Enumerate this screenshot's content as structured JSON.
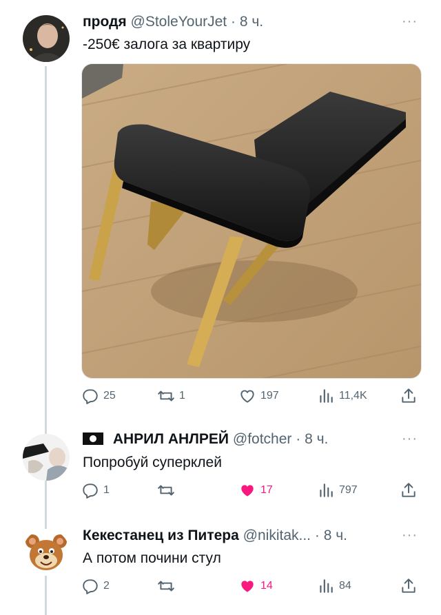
{
  "tweets": [
    {
      "name": "продя",
      "handle": "@StoleYourJet",
      "time": "8 ч.",
      "text": "-250€ залога за квартиру",
      "stats": {
        "replies": "25",
        "retweets": "1",
        "likes": "197",
        "views": "11,4K"
      },
      "liked": false
    },
    {
      "name": "АНРИЛ АНЛРЕЙ",
      "handle": "@fotcher",
      "time": "8 ч.",
      "text": "Попробуй суперклей",
      "stats": {
        "replies": "1",
        "retweets": "",
        "likes": "17",
        "views": "797"
      },
      "liked": true
    },
    {
      "name": "Кекестанец из Питера",
      "handle": "@nikitak...",
      "time": "8 ч.",
      "text": "А потом почини стул",
      "stats": {
        "replies": "2",
        "retweets": "",
        "likes": "14",
        "views": "84"
      },
      "liked": true
    }
  ],
  "separator": "·",
  "more_label": "···",
  "colors": {
    "like_active": "#f91880",
    "muted": "#536471",
    "thread_line": "#cfd9de"
  },
  "icons": [
    "reply-icon",
    "retweet-icon",
    "like-icon",
    "views-icon",
    "share-icon",
    "pirate-flag-icon"
  ]
}
